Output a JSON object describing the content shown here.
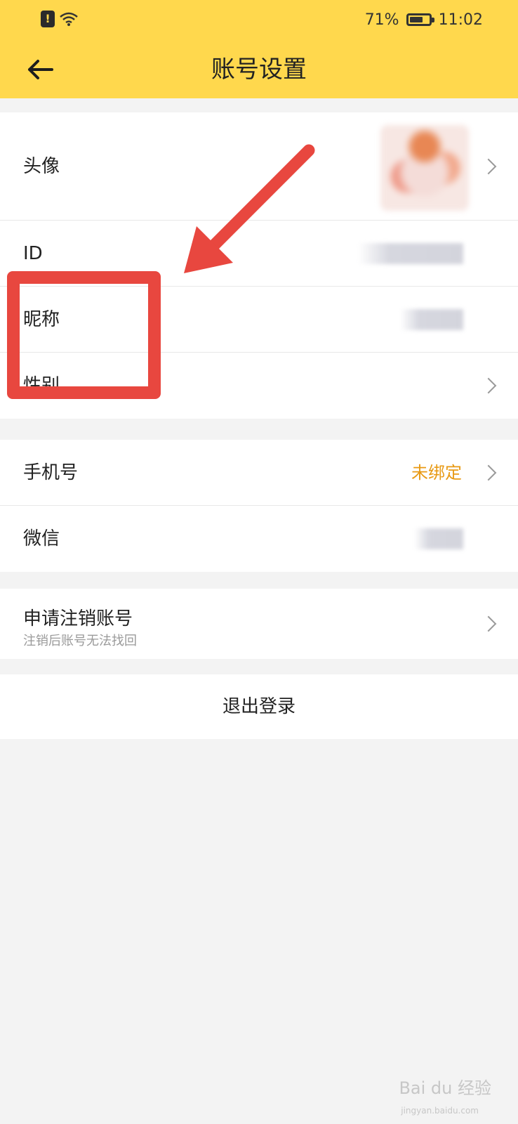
{
  "status_bar": {
    "battery": "71%",
    "time": "11:02",
    "battery_level": 0.71
  },
  "header": {
    "title": "账号设置"
  },
  "rows": {
    "avatar": "头像",
    "id": "ID",
    "nickname": "昵称",
    "gender": "性别",
    "phone": "手机号",
    "phone_value": "未绑定",
    "wechat": "微信",
    "cancel_title": "申请注销账号",
    "cancel_sub": "注销后账号无法找回"
  },
  "logout": "退出登录",
  "watermark": {
    "logo": "Bai du 经验",
    "url": "jingyan.baidu.com"
  },
  "colors": {
    "header_bg": "#ffd84d",
    "accent_orange": "#e89a14",
    "annotation_red": "#e8473f"
  }
}
